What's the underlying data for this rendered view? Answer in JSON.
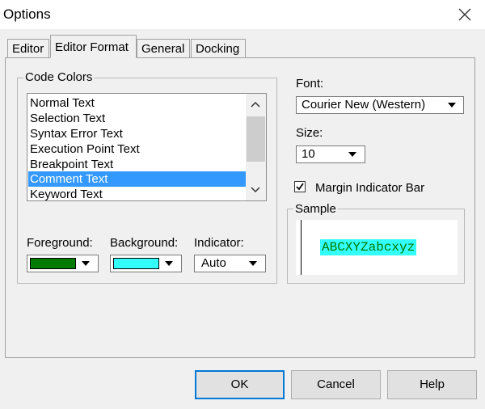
{
  "window": {
    "title": "Options"
  },
  "tabs": [
    {
      "label": "Editor",
      "active": false
    },
    {
      "label": "Editor Format",
      "active": true
    },
    {
      "label": "General",
      "active": false
    },
    {
      "label": "Docking",
      "active": false
    }
  ],
  "code_colors": {
    "legend": "Code Colors",
    "items": [
      "Normal Text",
      "Selection Text",
      "Syntax Error Text",
      "Execution Point Text",
      "Breakpoint Text",
      "Comment Text",
      "Keyword Text"
    ],
    "selected": "Comment Text",
    "foreground": {
      "label": "Foreground:",
      "color": "#007a00"
    },
    "background": {
      "label": "Background:",
      "color": "#33ffff"
    },
    "indicator": {
      "label": "Indicator:",
      "value": "Auto"
    }
  },
  "font": {
    "label": "Font:",
    "value": "Courier New (Western)"
  },
  "size": {
    "label": "Size:",
    "value": "10"
  },
  "margin_indicator": {
    "label": "Margin Indicator Bar",
    "checked": true
  },
  "sample": {
    "legend": "Sample",
    "text": "ABCXYZabcxyz",
    "text_color": "#007a00",
    "highlight": "#33ffff"
  },
  "buttons": {
    "ok": "OK",
    "cancel": "Cancel",
    "help": "Help"
  }
}
